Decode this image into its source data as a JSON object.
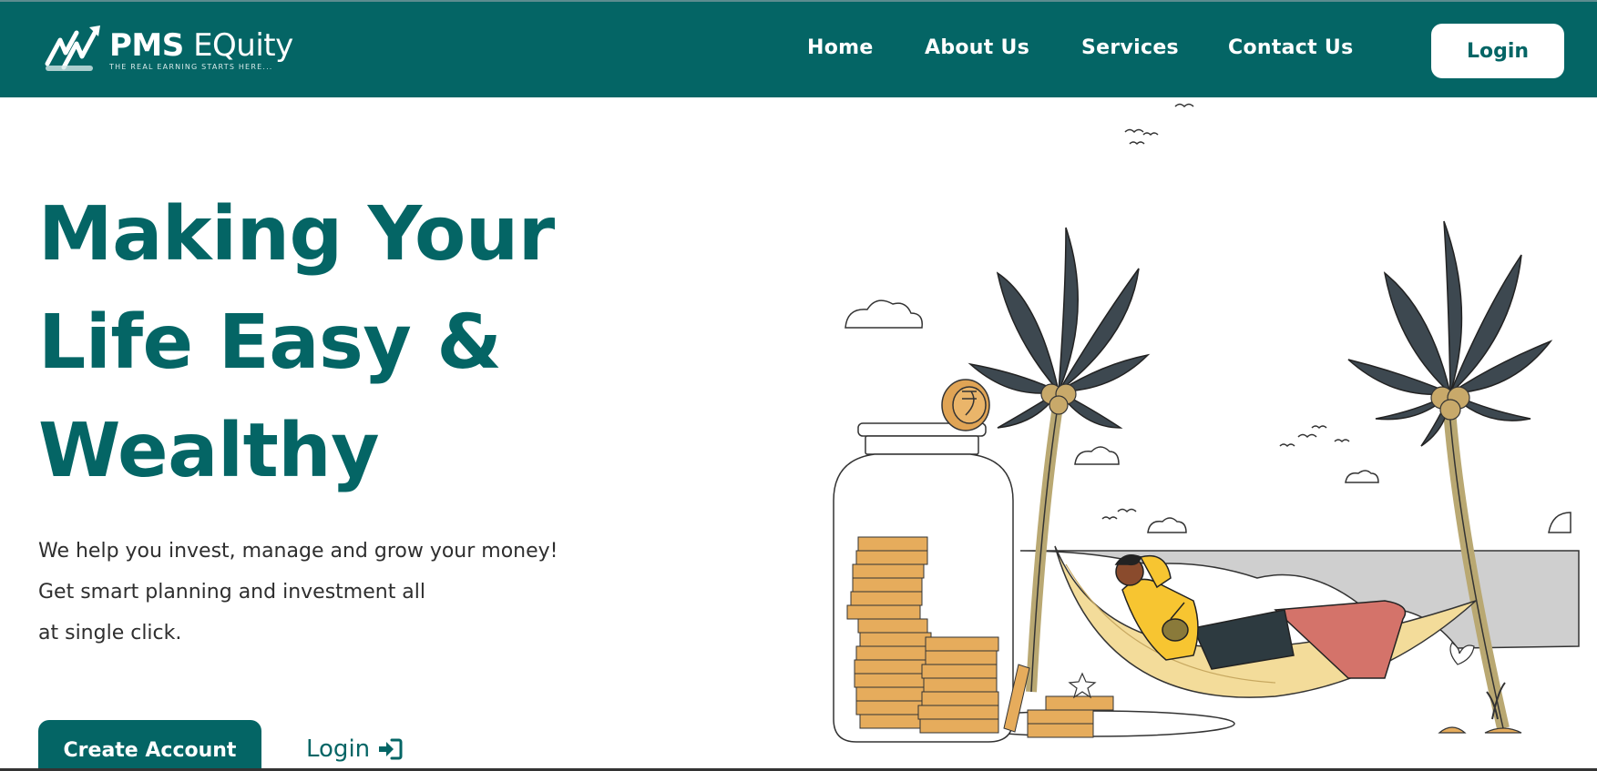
{
  "brand": {
    "name_part1": "PMS",
    "name_part2": "EQuity",
    "tagline": "THE REAL EARNING STARTS HERE..."
  },
  "nav": {
    "items": [
      {
        "label": "Home"
      },
      {
        "label": "About Us"
      },
      {
        "label": "Services"
      },
      {
        "label": "Contact Us"
      }
    ],
    "login_label": "Login"
  },
  "hero": {
    "title_lines": [
      "Making Your",
      "Life Easy &",
      "Wealthy"
    ],
    "description_lines": [
      "We help you invest, manage and grow your money!",
      "Get smart planning and investment all",
      "at single click."
    ],
    "create_account_label": "Create Account",
    "login_link_label": "Login"
  },
  "colors": {
    "primary": "#046565",
    "accent": "#f39c32",
    "text": "#2e2e2e",
    "background": "#ffffff"
  },
  "icons": [
    "brand-logo-icon",
    "sign-in-arrow-icon",
    "piggy-jar-illustration"
  ]
}
